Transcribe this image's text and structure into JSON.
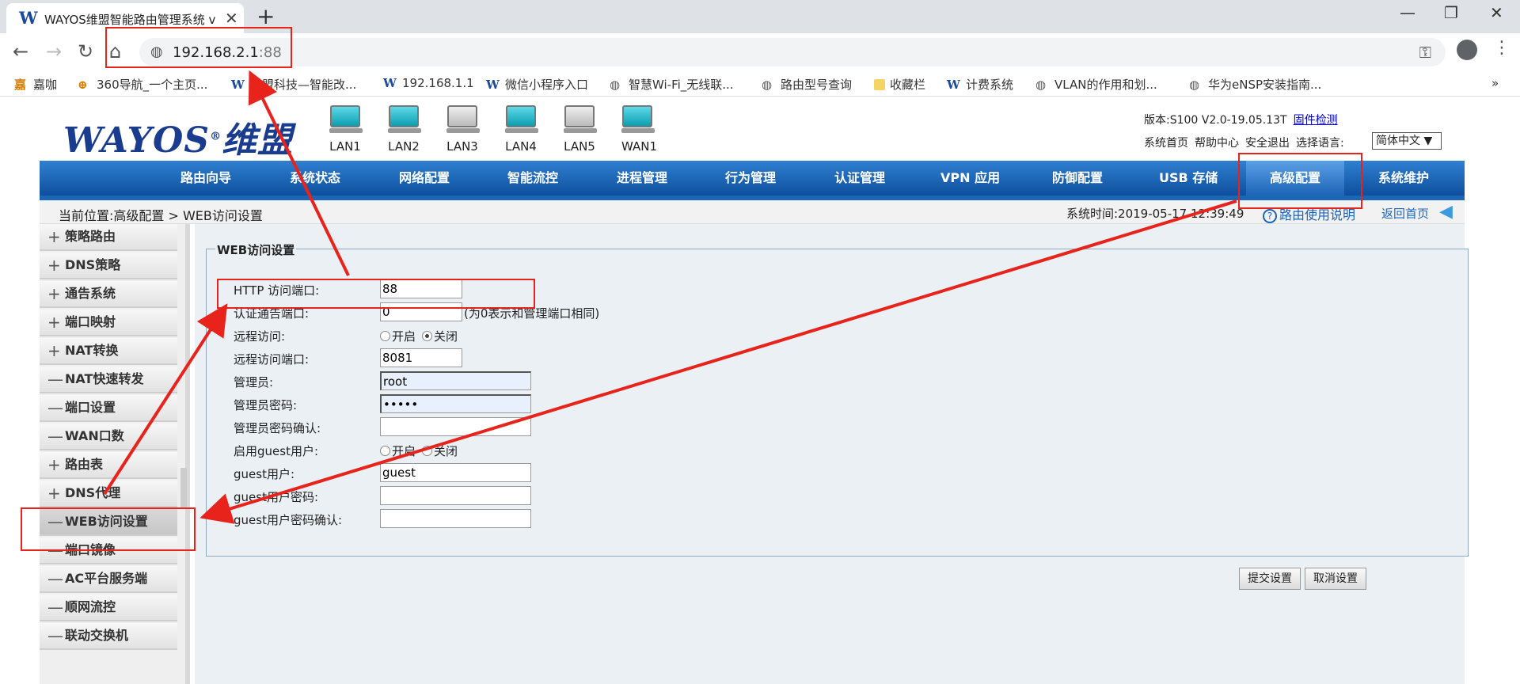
{
  "browser": {
    "tab_title": "WAYOS维盟智能路由管理系统 v",
    "tab_favicon": "W",
    "url_host": "192.168.2.1",
    "url_port": ":88",
    "bookmarks": [
      {
        "icon": "嘉",
        "label": "嘉咖"
      },
      {
        "icon": "⊕",
        "label": "360导航_一个主页..."
      },
      {
        "icon": "W",
        "label": "维盟科技—智能改..."
      },
      {
        "icon": "W",
        "label": "192.168.1.1"
      },
      {
        "icon": "W",
        "label": "微信小程序入口"
      },
      {
        "icon": "◍",
        "label": "智慧Wi-Fi_无线联..."
      },
      {
        "icon": "◍",
        "label": "路由型号查询"
      },
      {
        "icon": "",
        "label": "收藏栏"
      },
      {
        "icon": "W",
        "label": "计费系统"
      },
      {
        "icon": "◍",
        "label": "VLAN的作用和划..."
      },
      {
        "icon": "◍",
        "label": "华为eNSP安装指南..."
      }
    ],
    "more": "»"
  },
  "header": {
    "logo": "WAYOS",
    "logo_cn": "维盟",
    "ports": [
      {
        "label": "LAN1",
        "state": "on"
      },
      {
        "label": "LAN2",
        "state": "on"
      },
      {
        "label": "LAN3",
        "state": "off"
      },
      {
        "label": "LAN4",
        "state": "on"
      },
      {
        "label": "LAN5",
        "state": "off"
      },
      {
        "label": "WAN1",
        "state": "on"
      }
    ],
    "version": "版本:S100 V2.0-19.05.13T",
    "firmware_check": "固件检测",
    "links": [
      "系统首页",
      "帮助中心",
      "安全退出",
      "选择语言:"
    ],
    "language": "简体中文 ▼"
  },
  "nav": {
    "items": [
      "路由向导",
      "系统状态",
      "网络配置",
      "智能流控",
      "进程管理",
      "行为管理",
      "认证管理",
      "VPN 应用",
      "防御配置",
      "USB 存储",
      "高级配置",
      "系统维护"
    ],
    "active": "高级配置"
  },
  "crumb": {
    "path": "当前位置:高级配置 > WEB访问设置",
    "systime": "系统时间:2019-05-17 12:39:49",
    "help": "路由使用说明",
    "home": "返回首页"
  },
  "sidebar": {
    "items": [
      {
        "sym": "+",
        "label": "策略路由"
      },
      {
        "sym": "+",
        "label": "DNS策略"
      },
      {
        "sym": "+",
        "label": "通告系统"
      },
      {
        "sym": "+",
        "label": "端口映射"
      },
      {
        "sym": "+",
        "label": "NAT转换"
      },
      {
        "sym": "—",
        "label": "NAT快速转发"
      },
      {
        "sym": "—",
        "label": "端口设置"
      },
      {
        "sym": "—",
        "label": "WAN口数"
      },
      {
        "sym": "+",
        "label": "路由表"
      },
      {
        "sym": "+",
        "label": "DNS代理"
      },
      {
        "sym": "—",
        "label": "WEB访问设置"
      },
      {
        "sym": "—",
        "label": "端口镜像"
      },
      {
        "sym": "—",
        "label": "AC平台服务端"
      },
      {
        "sym": "—",
        "label": "顺网流控"
      },
      {
        "sym": "—",
        "label": "联动交换机"
      }
    ],
    "active_index": 10
  },
  "form": {
    "legend": "WEB访问设置",
    "http_port_label": "HTTP 访问端口:",
    "http_port_value": "88",
    "auth_port_label": "认证通告端口:",
    "auth_port_value": "0",
    "auth_port_hint": "(为0表示和管理端口相同)",
    "remote_label": "远程访问:",
    "remote_on": "开启",
    "remote_off": "关闭",
    "remote_port_label": "远程访问端口:",
    "remote_port_value": "8081",
    "admin_label": "管理员:",
    "admin_value": "root",
    "admin_pwd_label": "管理员密码:",
    "admin_pwd_value": "•••••",
    "admin_pwd_confirm_label": "管理员密码确认:",
    "guest_enable_label": "启用guest用户:",
    "guest_on": "开启",
    "guest_off": "关闭",
    "guest_user_label": "guest用户:",
    "guest_user_value": "guest",
    "guest_pwd_label": "guest用户密码:",
    "guest_pwd_confirm_label": "guest用户密码确认:",
    "submit": "提交设置",
    "cancel": "取消设置"
  },
  "colors": {
    "nav_blue": "#1c66b6",
    "annotation_red": "#e8231c",
    "link_blue": "#1a65c0"
  }
}
